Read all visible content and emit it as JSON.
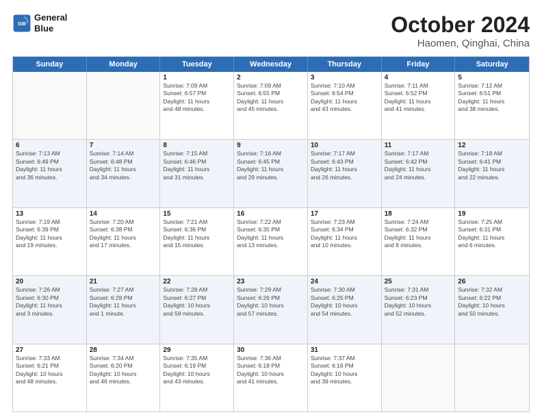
{
  "header": {
    "logo_line1": "General",
    "logo_line2": "Blue",
    "month_year": "October 2024",
    "location": "Haomen, Qinghai, China"
  },
  "days_of_week": [
    "Sunday",
    "Monday",
    "Tuesday",
    "Wednesday",
    "Thursday",
    "Friday",
    "Saturday"
  ],
  "weeks": [
    [
      {
        "day": "",
        "info": ""
      },
      {
        "day": "",
        "info": ""
      },
      {
        "day": "1",
        "info": "Sunrise: 7:09 AM\nSunset: 6:57 PM\nDaylight: 11 hours\nand 48 minutes."
      },
      {
        "day": "2",
        "info": "Sunrise: 7:09 AM\nSunset: 6:55 PM\nDaylight: 11 hours\nand 45 minutes."
      },
      {
        "day": "3",
        "info": "Sunrise: 7:10 AM\nSunset: 6:54 PM\nDaylight: 11 hours\nand 43 minutes."
      },
      {
        "day": "4",
        "info": "Sunrise: 7:11 AM\nSunset: 6:52 PM\nDaylight: 11 hours\nand 41 minutes."
      },
      {
        "day": "5",
        "info": "Sunrise: 7:12 AM\nSunset: 6:51 PM\nDaylight: 11 hours\nand 38 minutes."
      }
    ],
    [
      {
        "day": "6",
        "info": "Sunrise: 7:13 AM\nSunset: 6:49 PM\nDaylight: 11 hours\nand 36 minutes."
      },
      {
        "day": "7",
        "info": "Sunrise: 7:14 AM\nSunset: 6:48 PM\nDaylight: 11 hours\nand 34 minutes."
      },
      {
        "day": "8",
        "info": "Sunrise: 7:15 AM\nSunset: 6:46 PM\nDaylight: 11 hours\nand 31 minutes."
      },
      {
        "day": "9",
        "info": "Sunrise: 7:16 AM\nSunset: 6:45 PM\nDaylight: 11 hours\nand 29 minutes."
      },
      {
        "day": "10",
        "info": "Sunrise: 7:17 AM\nSunset: 6:43 PM\nDaylight: 11 hours\nand 26 minutes."
      },
      {
        "day": "11",
        "info": "Sunrise: 7:17 AM\nSunset: 6:42 PM\nDaylight: 11 hours\nand 24 minutes."
      },
      {
        "day": "12",
        "info": "Sunrise: 7:18 AM\nSunset: 6:41 PM\nDaylight: 11 hours\nand 22 minutes."
      }
    ],
    [
      {
        "day": "13",
        "info": "Sunrise: 7:19 AM\nSunset: 6:39 PM\nDaylight: 11 hours\nand 19 minutes."
      },
      {
        "day": "14",
        "info": "Sunrise: 7:20 AM\nSunset: 6:38 PM\nDaylight: 11 hours\nand 17 minutes."
      },
      {
        "day": "15",
        "info": "Sunrise: 7:21 AM\nSunset: 6:36 PM\nDaylight: 11 hours\nand 15 minutes."
      },
      {
        "day": "16",
        "info": "Sunrise: 7:22 AM\nSunset: 6:35 PM\nDaylight: 11 hours\nand 13 minutes."
      },
      {
        "day": "17",
        "info": "Sunrise: 7:23 AM\nSunset: 6:34 PM\nDaylight: 11 hours\nand 10 minutes."
      },
      {
        "day": "18",
        "info": "Sunrise: 7:24 AM\nSunset: 6:32 PM\nDaylight: 11 hours\nand 8 minutes."
      },
      {
        "day": "19",
        "info": "Sunrise: 7:25 AM\nSunset: 6:31 PM\nDaylight: 11 hours\nand 6 minutes."
      }
    ],
    [
      {
        "day": "20",
        "info": "Sunrise: 7:26 AM\nSunset: 6:30 PM\nDaylight: 11 hours\nand 3 minutes."
      },
      {
        "day": "21",
        "info": "Sunrise: 7:27 AM\nSunset: 6:28 PM\nDaylight: 11 hours\nand 1 minute."
      },
      {
        "day": "22",
        "info": "Sunrise: 7:28 AM\nSunset: 6:27 PM\nDaylight: 10 hours\nand 59 minutes."
      },
      {
        "day": "23",
        "info": "Sunrise: 7:29 AM\nSunset: 6:26 PM\nDaylight: 10 hours\nand 57 minutes."
      },
      {
        "day": "24",
        "info": "Sunrise: 7:30 AM\nSunset: 6:25 PM\nDaylight: 10 hours\nand 54 minutes."
      },
      {
        "day": "25",
        "info": "Sunrise: 7:31 AM\nSunset: 6:23 PM\nDaylight: 10 hours\nand 52 minutes."
      },
      {
        "day": "26",
        "info": "Sunrise: 7:32 AM\nSunset: 6:22 PM\nDaylight: 10 hours\nand 50 minutes."
      }
    ],
    [
      {
        "day": "27",
        "info": "Sunrise: 7:33 AM\nSunset: 6:21 PM\nDaylight: 10 hours\nand 48 minutes."
      },
      {
        "day": "28",
        "info": "Sunrise: 7:34 AM\nSunset: 6:20 PM\nDaylight: 10 hours\nand 46 minutes."
      },
      {
        "day": "29",
        "info": "Sunrise: 7:35 AM\nSunset: 6:19 PM\nDaylight: 10 hours\nand 43 minutes."
      },
      {
        "day": "30",
        "info": "Sunrise: 7:36 AM\nSunset: 6:18 PM\nDaylight: 10 hours\nand 41 minutes."
      },
      {
        "day": "31",
        "info": "Sunrise: 7:37 AM\nSunset: 6:16 PM\nDaylight: 10 hours\nand 39 minutes."
      },
      {
        "day": "",
        "info": ""
      },
      {
        "day": "",
        "info": ""
      }
    ]
  ]
}
